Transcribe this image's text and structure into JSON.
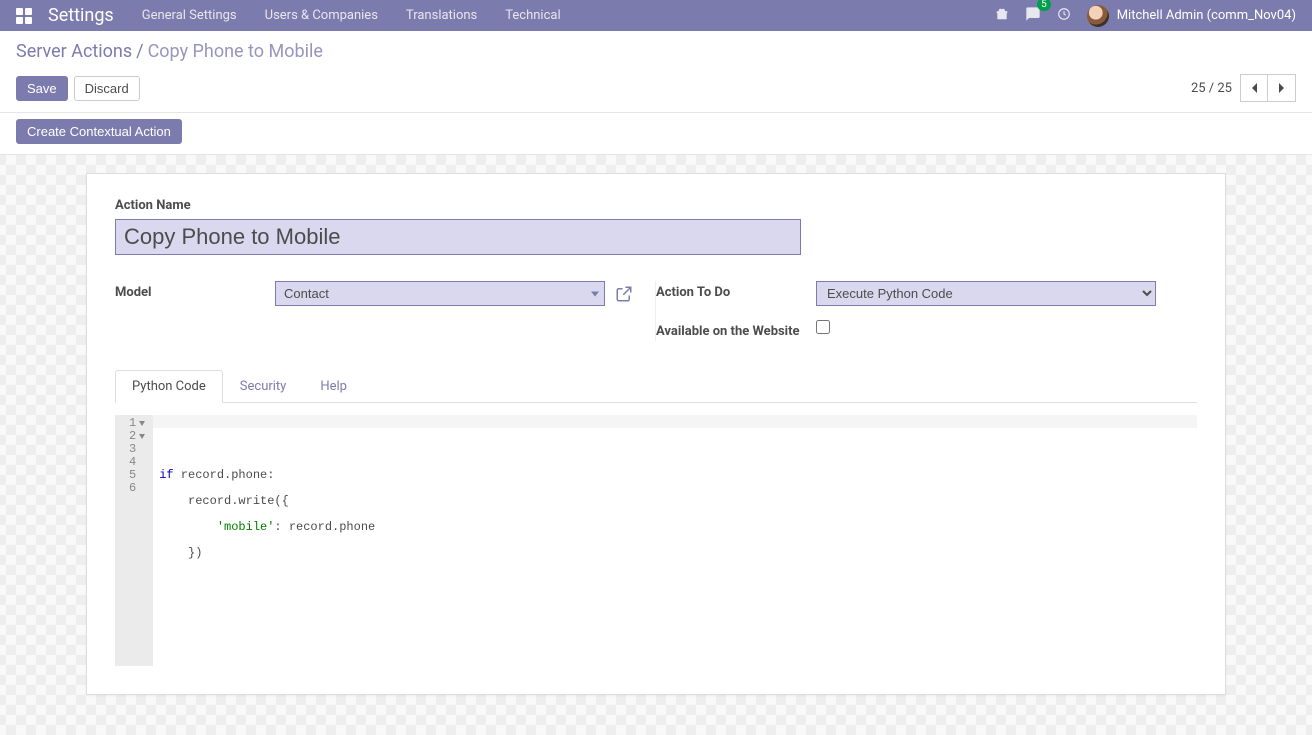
{
  "navbar": {
    "brand": "Settings",
    "menu": [
      "General Settings",
      "Users & Companies",
      "Translations",
      "Technical"
    ],
    "messages_badge": "5",
    "user_name": "Mitchell Admin (comm_Nov04)"
  },
  "breadcrumb": {
    "root": "Server Actions",
    "sep": "/",
    "current": "Copy Phone to Mobile"
  },
  "buttons": {
    "save": "Save",
    "discard": "Discard",
    "create_contextual": "Create Contextual Action"
  },
  "pager": {
    "text": "25 / 25"
  },
  "form": {
    "action_name_label": "Action Name",
    "action_name_value": "Copy Phone to Mobile",
    "model_label": "Model",
    "model_value": "Contact",
    "action_to_do_label": "Action To Do",
    "action_to_do_value": "Execute Python Code",
    "available_label": "Available on the Website",
    "available_checked": false
  },
  "tabs": [
    "Python Code",
    "Security",
    "Help"
  ],
  "code": {
    "lines": [
      {
        "n": "1",
        "fold": true
      },
      {
        "n": "2",
        "fold": true
      },
      {
        "n": "3",
        "fold": false
      },
      {
        "n": "4",
        "fold": false
      },
      {
        "n": "5",
        "fold": false
      },
      {
        "n": "6",
        "fold": false
      }
    ],
    "tok": {
      "if": "if",
      "cond": " record.phone:",
      "l2": "    record.write({",
      "l3a": "        ",
      "l3str": "'mobile'",
      "l3b": ": record.phone",
      "l4": "    })"
    }
  }
}
